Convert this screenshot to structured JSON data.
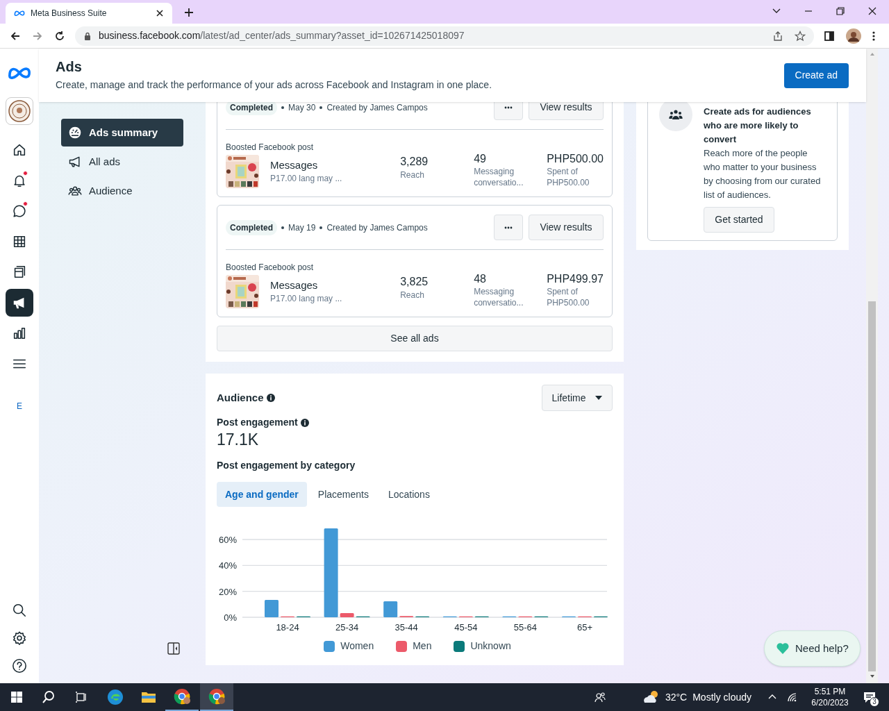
{
  "browser": {
    "tab_title": "Meta Business Suite",
    "url_host": "business.facebook.com",
    "url_path": "/latest/ad_center/ads_summary?asset_id=102671425018097"
  },
  "header": {
    "title": "Ads",
    "subtitle": "Create, manage and track the performance of your ads across Facebook and Instagram in one place.",
    "create_button": "Create ad"
  },
  "rail": {
    "items": [
      {
        "kind": "home",
        "badge": false,
        "selected": false
      },
      {
        "kind": "bell",
        "badge": true,
        "selected": false
      },
      {
        "kind": "chat",
        "badge": true,
        "selected": false
      },
      {
        "kind": "table",
        "badge": false,
        "selected": false
      },
      {
        "kind": "pages",
        "badge": false,
        "selected": false
      },
      {
        "kind": "megaphone",
        "badge": false,
        "selected": true
      },
      {
        "kind": "chart",
        "badge": false,
        "selected": false
      },
      {
        "kind": "menu",
        "badge": false,
        "selected": false
      }
    ],
    "account_letter": "E"
  },
  "nav": {
    "items": [
      {
        "kind": "gauge",
        "label": "Ads summary",
        "selected": true
      },
      {
        "kind": "megaphone",
        "label": "All ads",
        "selected": false
      },
      {
        "kind": "people",
        "label": "Audience",
        "selected": false
      }
    ]
  },
  "ads": [
    {
      "status": "Completed",
      "date": "May 30",
      "creator": "Created by James Campos",
      "view_button": "View results",
      "type": "Boosted Facebook post",
      "name": "Messages",
      "description": "P17.00 lang may ...",
      "reach": "3,289",
      "reach_label": "Reach",
      "results": "49",
      "results_label": "Messaging conversatio...",
      "spent": "PHP500.00",
      "spent_label": "Spent of PHP500.00"
    },
    {
      "status": "Completed",
      "date": "May 19",
      "creator": "Created by James Campos",
      "view_button": "View results",
      "type": "Boosted Facebook post",
      "name": "Messages",
      "description": "P17.00 lang may ...",
      "reach": "3,825",
      "reach_label": "Reach",
      "results": "48",
      "results_label": "Messaging conversatio...",
      "spent": "PHP499.97",
      "spent_label": "Spent of PHP500.00"
    }
  ],
  "see_all": "See all ads",
  "audience": {
    "title": "Audience",
    "period": "Lifetime",
    "metric_label": "Post engagement",
    "metric_value": "17.1K",
    "category_title": "Post engagement by category",
    "tabs": [
      {
        "label": "Age and gender",
        "selected": true
      },
      {
        "label": "Placements",
        "selected": false
      },
      {
        "label": "Locations",
        "selected": false
      }
    ],
    "chart_data": {
      "type": "bar",
      "grid": true,
      "categories": [
        "18-24",
        "25-34",
        "35-44",
        "45-54",
        "55-64",
        "65+"
      ],
      "ylim": [
        0,
        70
      ],
      "yticks": [
        {
          "value": 0,
          "label": "0%"
        },
        {
          "value": 20,
          "label": "20%"
        },
        {
          "value": 40,
          "label": "40%"
        },
        {
          "value": 60,
          "label": "60%"
        }
      ],
      "series": [
        {
          "name": "Women",
          "color": "#4299d6",
          "values": [
            13.4,
            68.6,
            12.3,
            0.3,
            0.3,
            0.3
          ]
        },
        {
          "name": "Men",
          "color": "#ec5a6a",
          "values": [
            0.5,
            3.2,
            1.0,
            0.3,
            0.3,
            0.3
          ]
        },
        {
          "name": "Unknown",
          "color": "#0b7a7a",
          "values": [
            0.3,
            0.3,
            0.3,
            0.3,
            0.3,
            0.3
          ]
        }
      ]
    }
  },
  "promo": {
    "title": "Create ads for audiences who are more likely to convert",
    "body": "Reach more of the people who matter to your business by choosing from our curated list of audiences.",
    "button": "Get started"
  },
  "help": "Need help?",
  "taskbar": {
    "temperature": "32°C",
    "weather": "Mostly cloudy",
    "time": "5:51 PM",
    "date": "6/20/2023",
    "notifications": "3"
  }
}
